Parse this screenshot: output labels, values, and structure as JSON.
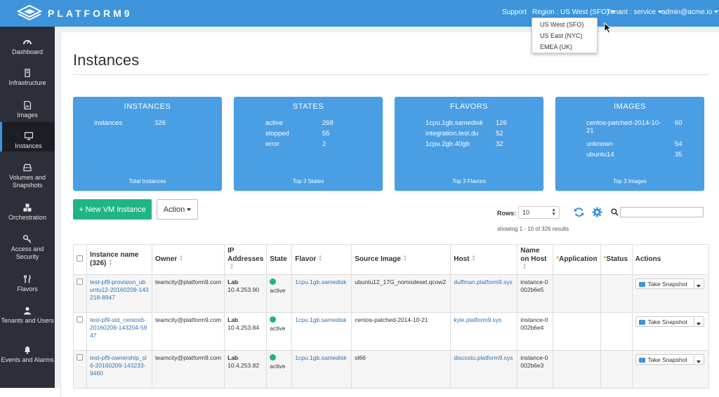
{
  "brand": {
    "name": "PLATFORM9"
  },
  "topnav": {
    "support": "Support",
    "region": "Region : US West (SFO)",
    "tenant": "Tenant : service",
    "user": "admin@acme.io"
  },
  "region_dropdown": {
    "options": [
      "US West (SFO)",
      "US East (NYC)",
      "EMEA (UK)"
    ]
  },
  "sidebar": {
    "items": [
      {
        "label": "Dashboard",
        "icon": "dashboard-icon"
      },
      {
        "label": "Infrastructure",
        "icon": "infrastructure-icon"
      },
      {
        "label": "Images",
        "icon": "images-icon"
      },
      {
        "label": "Instances",
        "icon": "monitor-icon",
        "active": true
      },
      {
        "label": "Volumes and Snapshots",
        "icon": "drive-icon"
      },
      {
        "label": "Orchestration",
        "icon": "cubes-icon"
      },
      {
        "label": "Access and Security",
        "icon": "key-icon"
      },
      {
        "label": "Flavors",
        "icon": "flavors-icon"
      },
      {
        "label": "Tenants and Users",
        "icon": "user-icon"
      },
      {
        "label": "Events and Alarms",
        "icon": "bell-icon"
      }
    ]
  },
  "page": {
    "title": "Instances"
  },
  "cards": [
    {
      "title": "INSTANCES",
      "rows": [
        {
          "k": "instances",
          "v": "326"
        }
      ],
      "footer": "Total Instances"
    },
    {
      "title": "STATES",
      "rows": [
        {
          "k": "active",
          "v": "268"
        },
        {
          "k": "stopped",
          "v": "55"
        },
        {
          "k": "error",
          "v": "2"
        }
      ],
      "footer": "Top 3 States"
    },
    {
      "title": "FLAVORS",
      "rows": [
        {
          "k": "1cpu.1gb.samedisk",
          "v": "126"
        },
        {
          "k": "integration.test.du",
          "v": "52"
        },
        {
          "k": "1cpu.2gb.40gb",
          "v": "32"
        }
      ],
      "footer": "Top 3 Flavors"
    },
    {
      "title": "IMAGES",
      "rows": [
        {
          "k": "centos-patched-2014-10-21",
          "v": "60"
        },
        {
          "k": "unknown",
          "v": "54"
        },
        {
          "k": "ubuntu14",
          "v": "35"
        }
      ],
      "footer": "Top 3 Images"
    }
  ],
  "toolbar": {
    "new_vm": "+ New VM Instance",
    "action": "Action",
    "rows_label": "Rows:",
    "rows_value": "10",
    "showing": "showing 1 - 10 of 326 results"
  },
  "table": {
    "headers": {
      "name": "Instance name (326)",
      "owner": "Owner",
      "ip": "IP Addresses",
      "state": "State",
      "flavor": "Flavor",
      "source": "Source Image",
      "host": "Host",
      "name_host": "Name on Host",
      "application": "Application",
      "status": "Status",
      "actions": "Actions"
    },
    "rows": [
      {
        "name": "test-pf9-provision_ubuntu12-20160209-143218-8947",
        "owner": "teamcity@platform9.com",
        "ip_label": "Lab",
        "ip": "10.4.253.90",
        "state": "active",
        "flavor": "1cpu.1gb.samedisk",
        "source": "ubuntu12_17G_nomodeset.qcow2",
        "host": "duffman.platform9.sys",
        "name_host": "instance-0002b6e5",
        "action": "Take Snapshot"
      },
      {
        "name": "test-pf9-std_centos6-20160209-143204-5947",
        "owner": "teamcity@platform9.com",
        "ip_label": "Lab",
        "ip": "10.4.253.84",
        "state": "active",
        "flavor": "1cpu.1gb.samedisk",
        "source": "centos-patched-2014-10-21",
        "host": "kyle.platform9.sys",
        "name_host": "instance-0002b6e4",
        "action": "Take Snapshot"
      },
      {
        "name": "test-pf9-ownership_sl6-20160209-143233-9460",
        "owner": "teamcity@platform9.com",
        "ip_label": "Lab",
        "ip": "10.4.253.82",
        "state": "active",
        "flavor": "1cpu.1gb.samedisk",
        "source": "sl66",
        "host": "discostu.platform9.sys",
        "name_host": "instance-0002b6e3",
        "action": "Take Snapshot"
      }
    ]
  },
  "colors": {
    "topbar": "#3d94db",
    "sidebar": "#2c2f38",
    "card": "#4a9ee3",
    "primary_button": "#20b486",
    "status_active": "#1cb488"
  }
}
